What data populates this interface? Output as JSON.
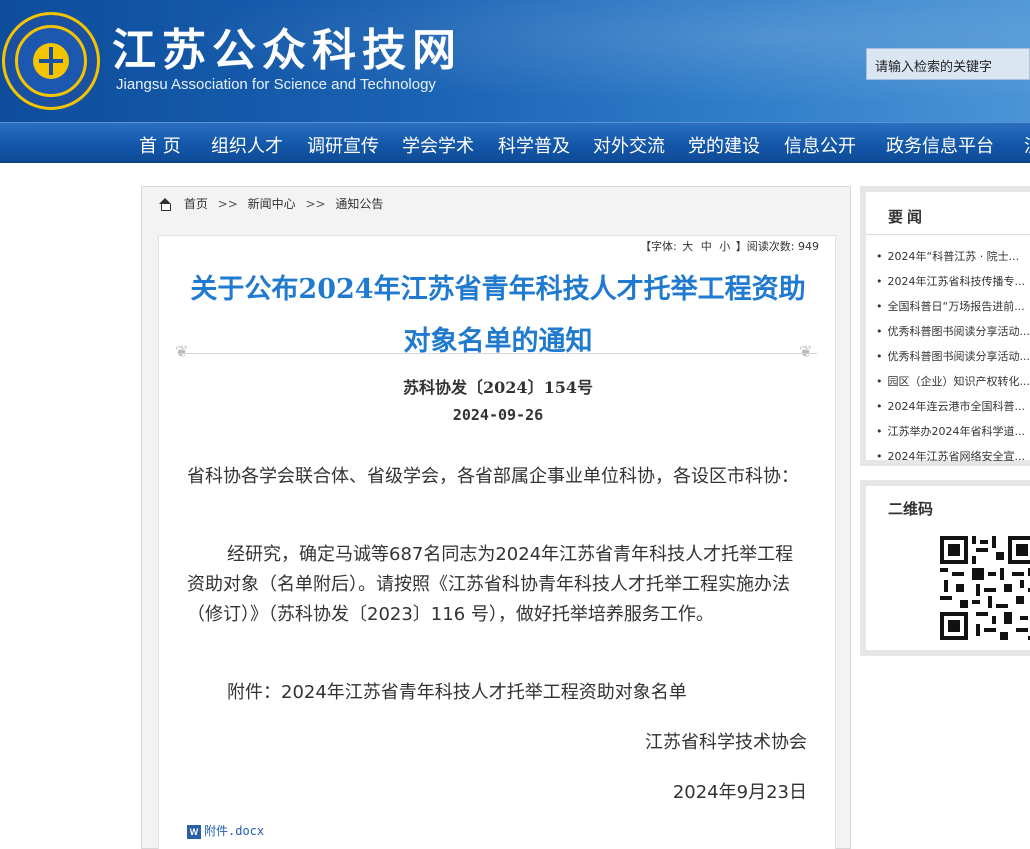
{
  "header": {
    "site_title": "江苏公众科技网",
    "site_subtitle": "Jiangsu Association for Science and Technology",
    "search_placeholder": "请输入检索的关键字"
  },
  "nav": {
    "items": [
      "首 页",
      "组织人才",
      "调研宣传",
      "学会学术",
      "科学普及",
      "对外交流",
      "党的建设",
      "信息公开",
      "政务信息平台",
      "泸"
    ]
  },
  "breadcrumb": {
    "home": "首页",
    "sep": ">>",
    "section": "新闻中心",
    "current": "通知公告"
  },
  "article": {
    "meta_prefix": "【字体:",
    "font_large": "大",
    "font_medium": "中",
    "font_small": "小",
    "meta_mid": "】阅读次数:",
    "read_count": "949",
    "title": "关于公布2024年江苏省青年科技人才托举工程资助对象名单的通知",
    "doc_number": "苏科协发〔2024〕154号",
    "date": "2024-09-26",
    "para1": "省科协各学会联合体、省级学会，各省部属企事业单位科协，各设区市科协：",
    "para2": "经研究，确定马诚等687名同志为2024年江苏省青年科技人才托举工程资助对象（名单附后）。请按照《江苏省科协青年科技人才托举工程实施办法（修订）》（苏科协发〔2023〕116 号），做好托举培养服务工作。",
    "para3": "附件：2024年江苏省青年科技人才托举工程资助对象名单",
    "sign_org": "江苏省科学技术协会",
    "sign_date": "2024年9月23日",
    "attachment_label": "附件.docx",
    "attachment_icon": "word-icon"
  },
  "sidebar": {
    "news_title": "要闻",
    "news": [
      "2024年“科普江苏 · 院士...",
      "2024年江苏省科技传播专...",
      "全国科普日“万场报告进前...",
      "优秀科普图书阅读分享活动...",
      "优秀科普图书阅读分享活动...",
      "园区（企业）知识产权转化...",
      "2024年连云港市全国科普...",
      "江苏举办2024年省科学道...",
      "2024年江苏省网络安全宣..."
    ],
    "qr_title": "二维码"
  },
  "colors": {
    "brand_blue": "#1356a8",
    "title_blue": "#1f7ad0",
    "logo_gold": "#f5c400"
  }
}
